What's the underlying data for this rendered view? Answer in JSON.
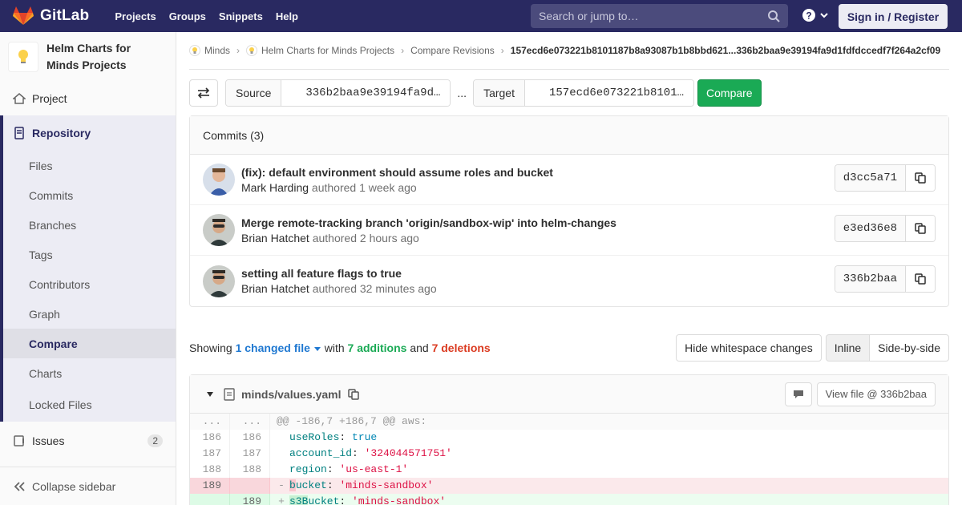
{
  "topbar": {
    "brand": "GitLab",
    "nav": [
      "Projects",
      "Groups",
      "Snippets",
      "Help"
    ],
    "search_placeholder": "Search or jump to…",
    "signin": "Sign in / Register"
  },
  "sidebar": {
    "project_name_line1": "Helm Charts for",
    "project_name_line2": "Minds Projects",
    "project": "Project",
    "repository": "Repository",
    "repo_items": [
      "Files",
      "Commits",
      "Branches",
      "Tags",
      "Contributors",
      "Graph",
      "Compare",
      "Charts",
      "Locked Files"
    ],
    "issues": "Issues",
    "issues_count": "2",
    "collapse": "Collapse sidebar"
  },
  "breadcrumb": {
    "items": [
      "Minds",
      "Helm Charts for Minds Projects",
      "Compare Revisions"
    ],
    "current": "157ecd6e073221b8101187b8a93087b1b8bbd621...336b2baa9e39194fa9d1fdfdccedf7f264a2cf09"
  },
  "compare": {
    "source_label": "Source",
    "source_value": "336b2baa9e39194fa9d…",
    "ellipsis": "...",
    "target_label": "Target",
    "target_value": "157ecd6e073221b8101…",
    "button": "Compare"
  },
  "commits": {
    "header": "Commits (3)",
    "items": [
      {
        "title": "(fix): default environment should assume roles and bucket",
        "author": "Mark Harding",
        "verb": "authored",
        "time": "1 week ago",
        "sha": "d3cc5a71"
      },
      {
        "title": "Merge remote-tracking branch 'origin/sandbox-wip' into helm-changes",
        "author": "Brian Hatchet",
        "verb": "authored",
        "time": "2 hours ago",
        "sha": "e3ed36e8"
      },
      {
        "title": "setting all feature flags to true",
        "author": "Brian Hatchet",
        "verb": "authored",
        "time": "32 minutes ago",
        "sha": "336b2baa"
      }
    ]
  },
  "stats": {
    "showing": "Showing",
    "changed": "1 changed file",
    "with": "with",
    "additions": "7 additions",
    "and": "and",
    "deletions": "7 deletions",
    "hide_ws": "Hide whitespace changes",
    "inline": "Inline",
    "side": "Side-by-side"
  },
  "file": {
    "path": "minds/values.yaml",
    "view_file": "View file @ 336b2baa",
    "hunk": "@@ -186,7 +186,7 @@ aws:",
    "hunk_old": "...",
    "hunk_new": "...",
    "lines": [
      {
        "old": "186",
        "new": "186",
        "key": "useRoles",
        "val": "true",
        "type": "bool"
      },
      {
        "old": "187",
        "new": "187",
        "key": "account_id",
        "val": "'324044571751'",
        "type": "str"
      },
      {
        "old": "188",
        "new": "188",
        "key": "region",
        "val": "'us-east-1'",
        "type": "str"
      }
    ],
    "del_line": {
      "old": "189",
      "sign": "-",
      "hl": "b",
      "rest": "ucket",
      "val": "'minds-sandbox'"
    },
    "add_line": {
      "new": "189",
      "sign": "+",
      "hl": "s3B",
      "rest": "ucket",
      "val": "'minds-sandbox'"
    }
  },
  "colors": {
    "nav_bg": "#292961",
    "green": "#1aaa55",
    "red": "#db3b21",
    "link": "#1f78d1"
  }
}
